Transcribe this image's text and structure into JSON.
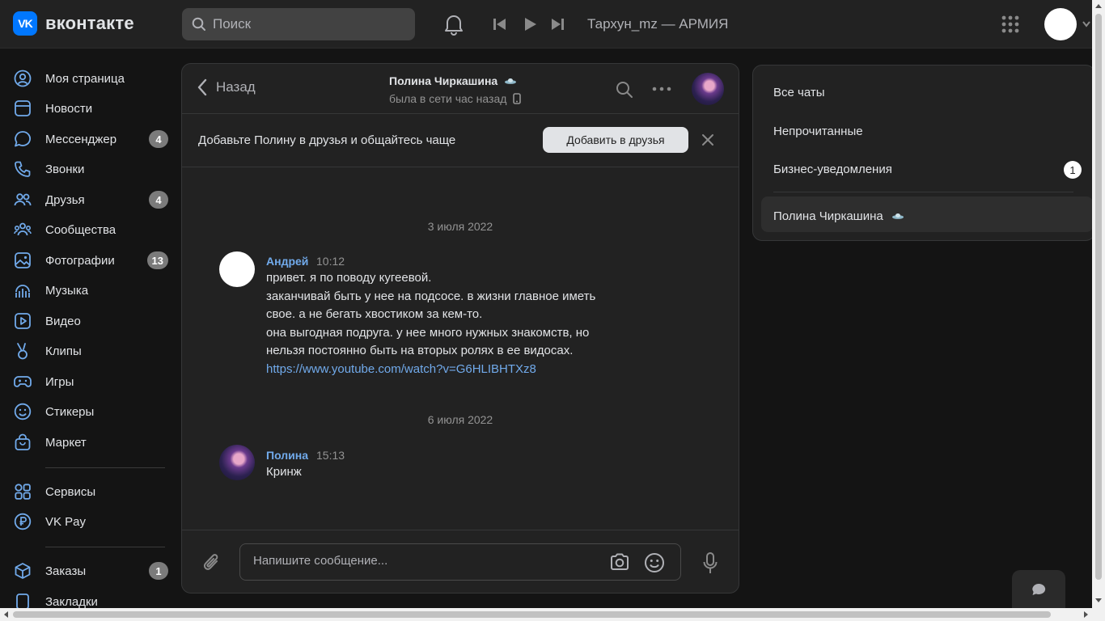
{
  "header": {
    "logo_mark": "VK",
    "logo_text": "вконтакте",
    "search_placeholder": "Поиск",
    "now_playing": "Тархун_mz — АРМИЯ"
  },
  "nav": {
    "items": [
      {
        "label": "Моя страница",
        "icon": "user-circle-icon",
        "badge": ""
      },
      {
        "label": "Новости",
        "icon": "newsfeed-icon",
        "badge": ""
      },
      {
        "label": "Мессенджер",
        "icon": "message-icon",
        "badge": "4"
      },
      {
        "label": "Звонки",
        "icon": "phone-icon",
        "badge": ""
      },
      {
        "label": "Друзья",
        "icon": "friends-icon",
        "badge": "4"
      },
      {
        "label": "Сообщества",
        "icon": "communities-icon",
        "badge": ""
      },
      {
        "label": "Фотографии",
        "icon": "photo-icon",
        "badge": "13"
      },
      {
        "label": "Музыка",
        "icon": "music-icon",
        "badge": ""
      },
      {
        "label": "Видео",
        "icon": "video-icon",
        "badge": ""
      },
      {
        "label": "Клипы",
        "icon": "clips-icon",
        "badge": ""
      },
      {
        "label": "Игры",
        "icon": "gamepad-icon",
        "badge": ""
      },
      {
        "label": "Стикеры",
        "icon": "smile-icon",
        "badge": ""
      },
      {
        "label": "Маркет",
        "icon": "market-icon",
        "badge": ""
      },
      {
        "label": "Сервисы",
        "icon": "services-icon",
        "badge": ""
      },
      {
        "label": "VK Pay",
        "icon": "vkpay-icon",
        "badge": ""
      },
      {
        "label": "Заказы",
        "icon": "box-icon",
        "badge": "1"
      },
      {
        "label": "Закладки",
        "icon": "bookmark-icon",
        "badge": ""
      }
    ]
  },
  "chat": {
    "back_label": "Назад",
    "peer_name": "Полина Чиркашина",
    "peer_status": "была в сети час назад",
    "promo_text": "Добавьте Полину в друзья и общайтесь чаще",
    "promo_button": "Добавить в друзья",
    "messages": [
      {
        "date": "3 июля 2022",
        "author": "Андрей",
        "time": "10:12",
        "lines": [
          "привет. я по поводу кугеевой.",
          "заканчивай быть у нее на подсосе. в жизни главное иметь",
          "свое. а не бегать хвостиком за кем-то.",
          "она выгодная подруга. у нее много нужных знакомств, но",
          "нельзя постоянно быть на вторых ролях в ее видосах."
        ],
        "link": "https://www.youtube.com/watch?v=G6HLIBHTXz8"
      },
      {
        "date": "6 июля 2022",
        "author": "Полина",
        "time": "15:13",
        "lines": [
          "Кринж"
        ]
      }
    ],
    "composer_placeholder": "Напишите сообщение..."
  },
  "folders": {
    "items": [
      {
        "label": "Все чаты",
        "badge": ""
      },
      {
        "label": "Непрочитанные",
        "badge": ""
      },
      {
        "label": "Бизнес-уведомления",
        "badge": "1"
      },
      {
        "label": "Полина Чиркашина",
        "badge": ""
      }
    ]
  },
  "colors": {
    "accent": "#71aaeb",
    "brand": "#0077ff",
    "background": "#141414",
    "panel": "#222222"
  }
}
